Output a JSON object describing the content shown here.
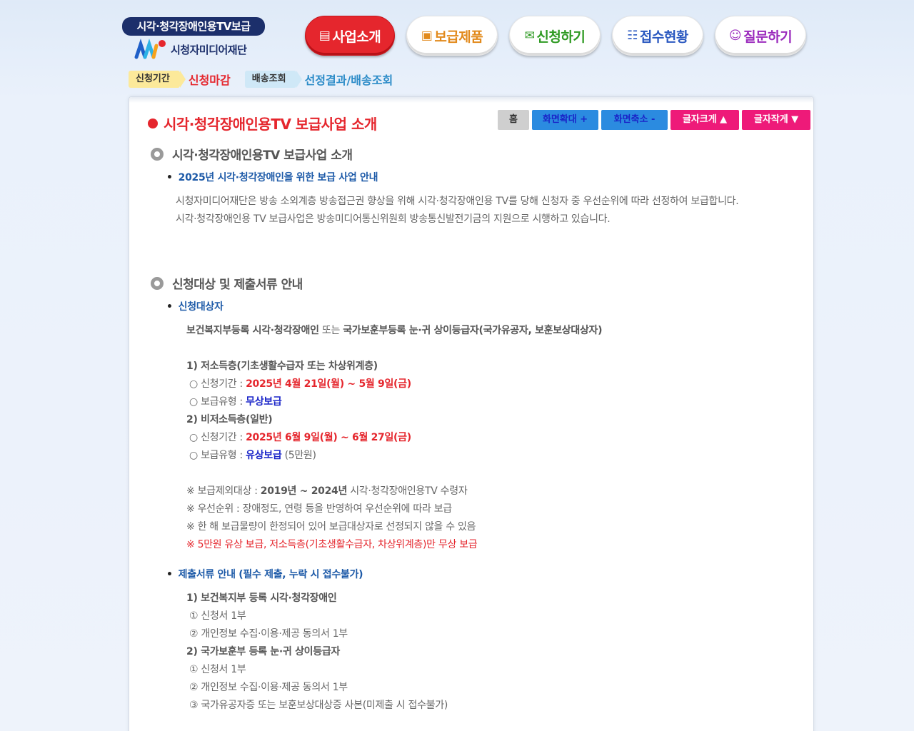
{
  "logo": {
    "top": "시각·청각장애인용TV보급",
    "name": "시청자미디어재단"
  },
  "nav": [
    {
      "label": "사업소개",
      "icon": "document-icon",
      "glyph": "▤",
      "active": true
    },
    {
      "label": "보급제품",
      "icon": "tv-icon",
      "glyph": "📺"
    },
    {
      "label": "신청하기",
      "icon": "mail-icon",
      "glyph": "✉"
    },
    {
      "label": "접수현황",
      "icon": "list-icon",
      "glyph": "☷"
    },
    {
      "label": "질문하기",
      "icon": "chat-icon",
      "glyph": "💬"
    }
  ],
  "status": {
    "period_tag": "신청기간",
    "period_value": "신청마감",
    "delivery_tag": "배송조회",
    "delivery_value": "선정결과/배송조회"
  },
  "page_title": "시각·청각장애인용TV 보급사업 소개",
  "tools": {
    "home": "홈",
    "zoom_in": "화면확대 +",
    "zoom_out": "화면축소 -",
    "font_up": "글자크게 ▲",
    "font_down": "글자작게 ▼"
  },
  "section1": {
    "heading": "시각·청각장애인용TV 보급사업 소개",
    "bullet": "2025년 시각·청각장애인을 위한 보급 사업 안내",
    "line1": "시청자미디어재단은 방송 소외계층 방송접근권 향상을 위해 시각·청각장애인용 TV를 당해 신청자 중 우선순위에 따라 선정하여 보급합니다.",
    "line2": "시각·청각장애인용 TV 보급사업은 방송미디어통신위원회 방송통신발전기금의 지원으로 시행하고 있습니다."
  },
  "section2": {
    "heading": "신청대상 및 제출서류 안내",
    "bullet1": "신청대상자",
    "target_a": "보건복지부등록 시각·청각장애인",
    "target_or": " 또는 ",
    "target_b": "국가보훈부등록 눈·귀 상이등급자(국가유공자, 보훈보상대상자)",
    "g1_title": "1) 저소득층(기초생활수급자 또는 차상위계층)",
    "g1_period_label": "○ 신청기간 : ",
    "g1_period": "2025년 4월 21일(월) ~ 5월 9일(금)",
    "g1_type_label": "○ 보급유형 : ",
    "g1_type": "무상보급",
    "g2_title": "2) 비저소득층(일반)",
    "g2_period_label": "○ 신청기간 : ",
    "g2_period": "2025년 6월 9일(월) ~ 6월 27일(금)",
    "g2_type_label": "○ 보급유형 : ",
    "g2_type": "유상보급",
    "g2_type_extra": " (5만원)",
    "note1_label": "※ 보급제외대상 : ",
    "note1_years": "2019년 ~ 2024년",
    "note1_rest": " 시각·청각장애인용TV 수령자",
    "note2": "※ 우선순위 : 장애정도, 연령 등을 반영하여 우선순위에 따라 보급",
    "note3": "※ 한 해 보급물량이 한정되어 있어 보급대상자로 선정되지 않을 수 있음",
    "note4": "※ 5만원 유상 보급, 저소득층(기초생활수급자, 차상위계층)만 무상 보급",
    "bullet2": "제출서류 안내 (필수 제출, 누락 시 접수불가)",
    "d1_title": "1) 보건복지부 등록 시각·청각장애인",
    "d1_i1": "① 신청서 1부",
    "d1_i2": "② 개인정보 수집·이용·제공 동의서 1부",
    "d2_title": "2) 국가보훈부 등록 눈·귀 상이등급자",
    "d2_i1": "① 신청서 1부",
    "d2_i2": "② 개인정보 수집·이용·제공 동의서 1부",
    "d2_i3": "③ 국가유공자증 또는 보훈보상대상증 사본(미제출 시 접수불가)"
  },
  "colors": {
    "accent_red": "#e5262d",
    "accent_blue": "#1d5aa8",
    "navy": "#1c2f6b",
    "tool_blue": "#2b8be0",
    "tool_pink": "#ee1a79"
  }
}
